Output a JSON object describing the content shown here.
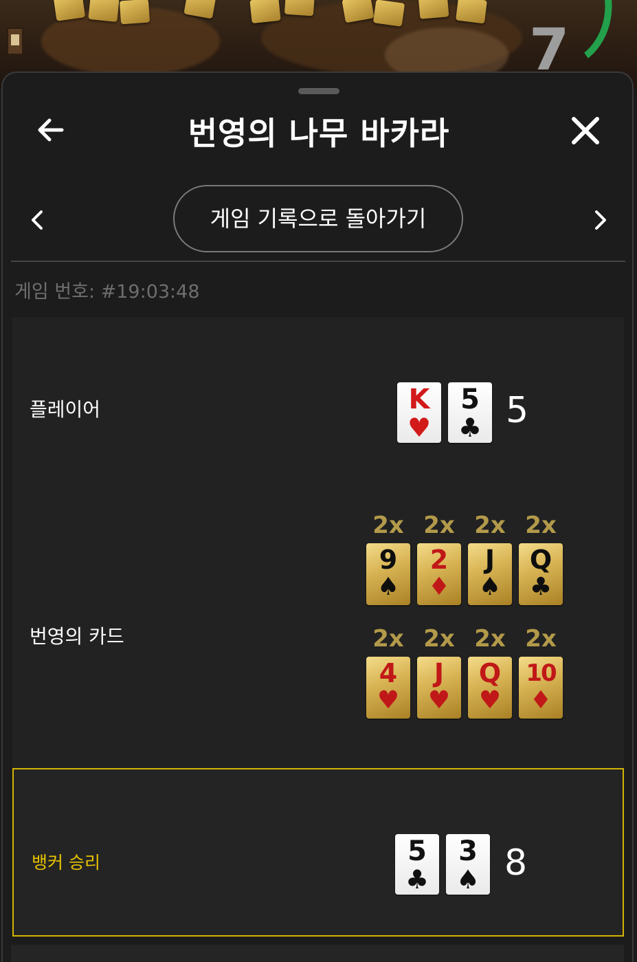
{
  "background": {
    "timer_value": "7",
    "timer_color": "#23a04b"
  },
  "header": {
    "title": "번영의 나무 바카라",
    "back_icon": "arrow-left-icon",
    "close_icon": "close-icon"
  },
  "nav": {
    "prev_icon": "chevron-left-icon",
    "next_icon": "chevron-right-icon",
    "history_button_label": "게임 기록으로 돌아가기"
  },
  "game": {
    "number_label": "게임 번호: #19:03:48"
  },
  "player": {
    "label": "플레이어",
    "cards": [
      {
        "rank": "K",
        "suit": "♥",
        "color": "red"
      },
      {
        "rank": "5",
        "suit": "♣",
        "color": "black"
      }
    ],
    "score": "5"
  },
  "prosperity": {
    "label": "번영의 카드",
    "rows": [
      [
        {
          "mult": "2x",
          "rank": "9",
          "suit": "♠",
          "color": "black"
        },
        {
          "mult": "2x",
          "rank": "2",
          "suit": "♦",
          "color": "red"
        },
        {
          "mult": "2x",
          "rank": "J",
          "suit": "♠",
          "color": "black"
        },
        {
          "mult": "2x",
          "rank": "Q",
          "suit": "♣",
          "color": "black"
        }
      ],
      [
        {
          "mult": "2x",
          "rank": "4",
          "suit": "♥",
          "color": "red"
        },
        {
          "mult": "2x",
          "rank": "J",
          "suit": "♥",
          "color": "red"
        },
        {
          "mult": "2x",
          "rank": "Q",
          "suit": "♥",
          "color": "red"
        },
        {
          "mult": "2x",
          "rank": "10",
          "suit": "♦",
          "color": "red"
        }
      ]
    ]
  },
  "banker": {
    "label": "뱅커 승리",
    "label_color": "#e8c400",
    "cards": [
      {
        "rank": "5",
        "suit": "♣",
        "color": "black"
      },
      {
        "rank": "3",
        "suit": "♠",
        "color": "black"
      }
    ],
    "score": "8"
  }
}
